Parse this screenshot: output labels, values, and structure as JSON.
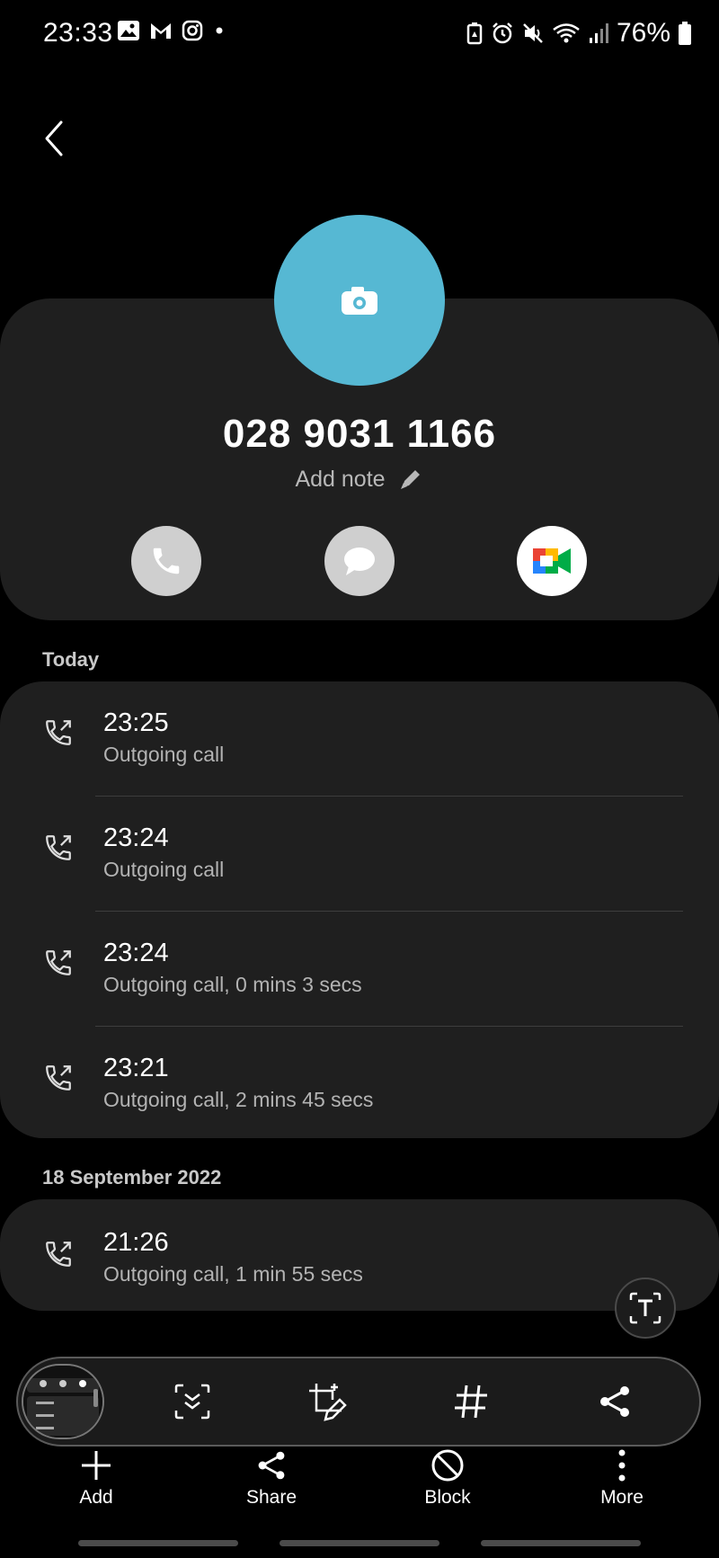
{
  "status_bar": {
    "time": "23:33",
    "battery": "76%"
  },
  "contact": {
    "number": "028 9031 1166",
    "add_note": "Add note"
  },
  "sections": [
    {
      "label": "Today",
      "calls": [
        {
          "time": "23:25",
          "desc": "Outgoing call"
        },
        {
          "time": "23:24",
          "desc": "Outgoing call"
        },
        {
          "time": "23:24",
          "desc": "Outgoing call, 0 mins 3 secs"
        },
        {
          "time": "23:21",
          "desc": "Outgoing call, 2 mins 45 secs"
        }
      ]
    },
    {
      "label": "18 September 2022",
      "calls": [
        {
          "time": "21:26",
          "desc": "Outgoing call, 1 min 55 secs"
        }
      ]
    }
  ],
  "bottom_nav": {
    "add": "Add",
    "share": "Share",
    "block": "Block",
    "more": "More"
  },
  "colors": {
    "avatar": "#56b8d3",
    "card": "#1f1f1f",
    "background": "#000000"
  }
}
